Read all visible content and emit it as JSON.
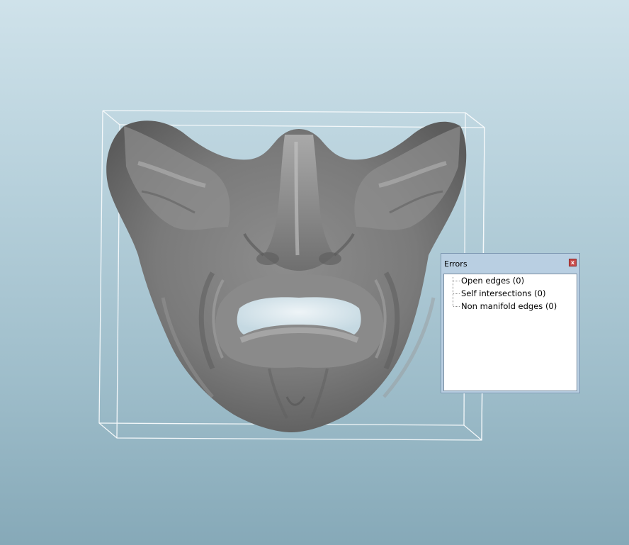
{
  "errors_panel": {
    "title": "Errors",
    "close_label": "x",
    "items": [
      {
        "label": "Open edges (0)"
      },
      {
        "label": "Self intersections (0)"
      },
      {
        "label": "Non manifold edges (0)"
      }
    ]
  }
}
